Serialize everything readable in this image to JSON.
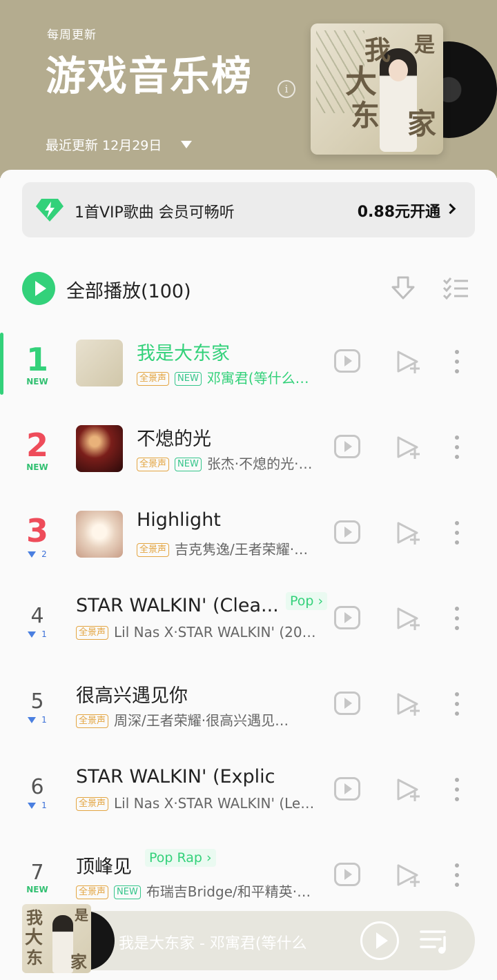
{
  "header": {
    "weekly_label": "每周更新",
    "title": "游戏音乐榜",
    "info_glyph": "i",
    "updated_label": "最近更新 12月29日",
    "cover_chars": [
      "我",
      "是",
      "大",
      "东",
      "家"
    ]
  },
  "vip_banner": {
    "text": "1首VIP歌曲 会员可畅听",
    "price_label": "0.88元开通"
  },
  "toolbar": {
    "play_all_label": "全部播放(100)"
  },
  "songs": [
    {
      "rank": "1",
      "trend": "NEW",
      "title": "我是大东家",
      "tags": [
        "全景声",
        "NEW"
      ],
      "subtitle": "邓寓君(等什么…",
      "active": true
    },
    {
      "rank": "2",
      "trend": "NEW",
      "title": "不熄的光",
      "tags": [
        "全景声",
        "NEW"
      ],
      "subtitle": "张杰·不熄的光·…"
    },
    {
      "rank": "3",
      "trend": "2",
      "trend_dir": "down",
      "title": "Highlight",
      "tags": [
        "全景声"
      ],
      "subtitle": "吉克隽逸/王者荣耀·…"
    },
    {
      "rank": "4",
      "trend": "1",
      "trend_dir": "down",
      "title": "STAR WALKIN' (Clea...",
      "genre": "Pop",
      "tags": [
        "全景声"
      ],
      "subtitle": "Lil Nas X·STAR WALKIN' (20…"
    },
    {
      "rank": "5",
      "trend": "1",
      "trend_dir": "down",
      "title": "很高兴遇见你",
      "tags": [
        "全景声"
      ],
      "subtitle": "周深/王者荣耀·很高兴遇见…"
    },
    {
      "rank": "6",
      "trend": "1",
      "trend_dir": "down",
      "title": "STAR WALKIN' (Explicit)",
      "tags": [
        "全景声"
      ],
      "subtitle": "Lil Nas X·STAR WALKIN' (Le…"
    },
    {
      "rank": "7",
      "trend": "NEW",
      "title": "顶峰见",
      "genre": "Pop Rap",
      "tags": [
        "全景声",
        "NEW"
      ],
      "subtitle": "布瑞吉Bridge/和平精英·…"
    }
  ],
  "mini_player": {
    "now_playing": "我是大东家 - 邓寓君(等什么"
  },
  "colors": {
    "accent": "#33d17a",
    "rank_red": "#ee4c5a",
    "header_bg": "#b4ac8f",
    "quality_tag": "#e3a542"
  }
}
